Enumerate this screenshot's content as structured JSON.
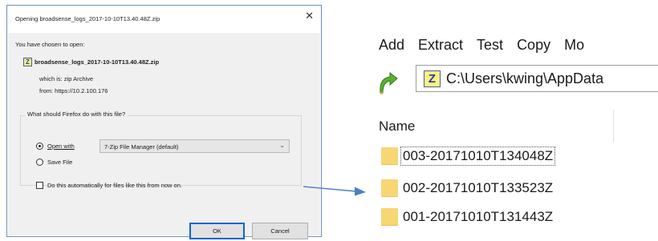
{
  "dialog": {
    "title": "Opening broadsense_logs_2017-10-10T13.40.48Z.zip",
    "chosen_label": "You have chosen to open:",
    "file_name": "broadsense_logs_2017-10-10T13.40.48Z.zip",
    "which_is": "which is: zip Archive",
    "from": "from: https://10.2.100.176",
    "question": "What should Firefox do with this file?",
    "open_with_label": "Open with",
    "open_with_value": "7-Zip File Manager (default)",
    "save_file_label": "Save File",
    "auto_label": "Do this automatically for files like this from now on.",
    "ok_label": "OK",
    "cancel_label": "Cancel",
    "open_with_selected": true,
    "auto_checked": false
  },
  "zip_manager": {
    "menu": [
      "Add",
      "Extract",
      "Test",
      "Copy",
      "Mo"
    ],
    "address": "C:\\Users\\kwing\\AppData",
    "column_name": "Name",
    "items": [
      {
        "name": "003-20171010T134048Z"
      },
      {
        "name": "002-20171010T133523Z"
      },
      {
        "name": "001-20171010T131443Z"
      }
    ]
  },
  "colors": {
    "dialog_border": "#6d8fb8",
    "dialog_bg": "#f0f0f0",
    "default_button_border": "#0a64d4",
    "arrow": "#4a7fc1",
    "folder": "#f7d774",
    "zip_icon": "#fbf08a"
  },
  "icons": [
    "close-icon",
    "zip-file-icon",
    "chevron-down-icon",
    "arrow-right-icon",
    "go-up-icon",
    "folder-icon"
  ]
}
